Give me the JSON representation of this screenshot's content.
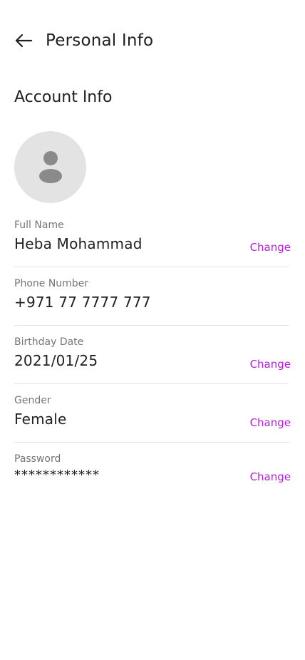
{
  "header": {
    "title": "Personal Info"
  },
  "section": {
    "title": "Account Info"
  },
  "fields": {
    "full_name": {
      "label": "Full Name",
      "value": "Heba Mohammad",
      "action": "Change"
    },
    "phone": {
      "label": "Phone Number",
      "value": "+971 77 7777 777"
    },
    "birthday": {
      "label": "Birthday Date",
      "value": "2021/01/25",
      "action": "Change"
    },
    "gender": {
      "label": "Gender",
      "value": "Female",
      "action": "Change"
    },
    "password": {
      "label": "Password",
      "value": "************",
      "action": "Change"
    }
  },
  "colors": {
    "accent": "#b51ddf",
    "avatar_bg": "#e3e3e3",
    "avatar_icon": "#8a8a8a",
    "label": "#757575",
    "text": "#1f1f24",
    "divider": "#e2e2e2"
  }
}
